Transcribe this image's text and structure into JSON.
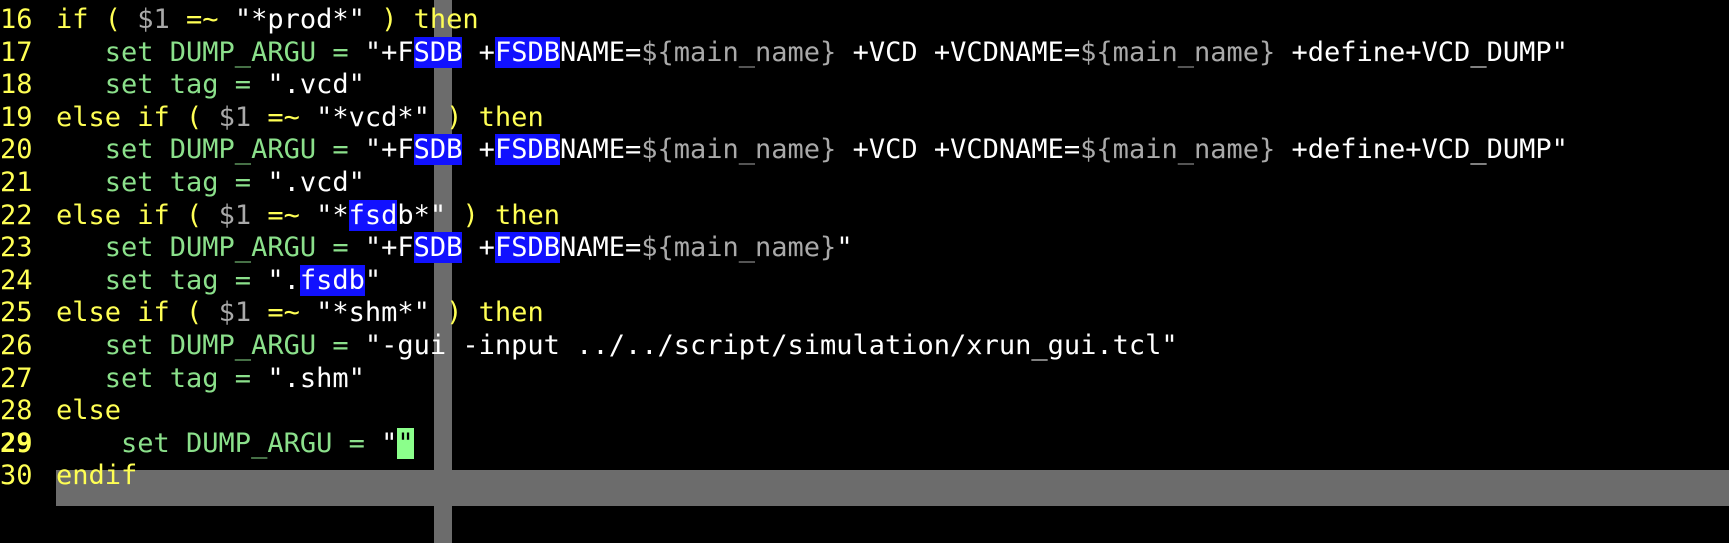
{
  "lines": [
    {
      "n": "16",
      "t": [
        {
          "c": "k",
          "x": "if ( "
        },
        {
          "c": "v",
          "x": "$1"
        },
        {
          "c": "k",
          "x": " =~ "
        },
        {
          "c": "s",
          "x": "\"*prod*\""
        },
        {
          "c": "k",
          "x": " ) then"
        }
      ]
    },
    {
      "n": "17",
      "t": [
        {
          "c": "n",
          "x": "   set DUMP_ARGU = "
        },
        {
          "c": "s",
          "x": "\"+F"
        },
        {
          "c": "s hl",
          "x": "SDB"
        },
        {
          "c": "s",
          "x": " +"
        },
        {
          "c": "s hl",
          "x": "FSDB"
        },
        {
          "c": "s",
          "x": "NAME="
        },
        {
          "c": "v",
          "x": "${main_name}"
        },
        {
          "c": "s",
          "x": " +VCD +VCDNAME="
        },
        {
          "c": "v",
          "x": "${main_name}"
        },
        {
          "c": "s",
          "x": " +define+VCD_DUMP\""
        }
      ]
    },
    {
      "n": "18",
      "t": [
        {
          "c": "n",
          "x": "   set tag = "
        },
        {
          "c": "s",
          "x": "\".vcd\""
        }
      ]
    },
    {
      "n": "19",
      "t": [
        {
          "c": "k",
          "x": "else if ( "
        },
        {
          "c": "v",
          "x": "$1"
        },
        {
          "c": "k",
          "x": " =~ "
        },
        {
          "c": "s",
          "x": "\"*vcd*\""
        },
        {
          "c": "k",
          "x": " ) then"
        }
      ]
    },
    {
      "n": "20",
      "t": [
        {
          "c": "n",
          "x": "   set DUMP_ARGU = "
        },
        {
          "c": "s",
          "x": "\"+F"
        },
        {
          "c": "s hl",
          "x": "SDB"
        },
        {
          "c": "s",
          "x": " +"
        },
        {
          "c": "s hl",
          "x": "FSDB"
        },
        {
          "c": "s",
          "x": "NAME="
        },
        {
          "c": "v",
          "x": "${main_name}"
        },
        {
          "c": "s",
          "x": " +VCD +VCDNAME="
        },
        {
          "c": "v",
          "x": "${main_name}"
        },
        {
          "c": "s",
          "x": " +define+VCD_DUMP\""
        }
      ]
    },
    {
      "n": "21",
      "t": [
        {
          "c": "n",
          "x": "   set tag = "
        },
        {
          "c": "s",
          "x": "\".vcd\""
        }
      ]
    },
    {
      "n": "22",
      "t": [
        {
          "c": "k",
          "x": "else if ( "
        },
        {
          "c": "v",
          "x": "$1"
        },
        {
          "c": "k",
          "x": " =~ "
        },
        {
          "c": "s",
          "x": "\"*"
        },
        {
          "c": "s hl",
          "x": "fsd"
        },
        {
          "c": "s",
          "x": "b*\""
        },
        {
          "c": "k",
          "x": " ) then"
        }
      ]
    },
    {
      "n": "23",
      "t": [
        {
          "c": "n",
          "x": "   set DUMP_ARGU = "
        },
        {
          "c": "s",
          "x": "\"+F"
        },
        {
          "c": "s hl",
          "x": "SDB"
        },
        {
          "c": "s",
          "x": " +"
        },
        {
          "c": "s hl",
          "x": "FSDB"
        },
        {
          "c": "s",
          "x": "NAME="
        },
        {
          "c": "v",
          "x": "${main_name}"
        },
        {
          "c": "s",
          "x": "\""
        }
      ]
    },
    {
      "n": "24",
      "t": [
        {
          "c": "n",
          "x": "   set tag = "
        },
        {
          "c": "s",
          "x": "\"."
        },
        {
          "c": "s hl",
          "x": "fsdb"
        },
        {
          "c": "s",
          "x": "\""
        }
      ]
    },
    {
      "n": "25",
      "t": [
        {
          "c": "k",
          "x": "else if ( "
        },
        {
          "c": "v",
          "x": "$1"
        },
        {
          "c": "k",
          "x": " =~ "
        },
        {
          "c": "s",
          "x": "\"*shm*\""
        },
        {
          "c": "k",
          "x": " ) then"
        }
      ]
    },
    {
      "n": "26",
      "t": [
        {
          "c": "n",
          "x": "   set DUMP_ARGU = "
        },
        {
          "c": "s",
          "x": "\"-gui -input ../../script/simulation/xrun_gui.tcl\""
        }
      ]
    },
    {
      "n": "27",
      "t": [
        {
          "c": "n",
          "x": "   set tag = "
        },
        {
          "c": "s",
          "x": "\".shm\""
        }
      ]
    },
    {
      "n": "28",
      "t": [
        {
          "c": "k",
          "x": "else"
        }
      ]
    },
    {
      "n": "29",
      "cur": true,
      "t": [
        {
          "c": "n",
          "x": "    set DUMP_ARGU = "
        },
        {
          "c": "s",
          "x": "\""
        },
        {
          "c": "cursor",
          "x": "\""
        }
      ]
    },
    {
      "n": "30",
      "t": [
        {
          "c": "k",
          "x": "endif"
        }
      ]
    }
  ]
}
